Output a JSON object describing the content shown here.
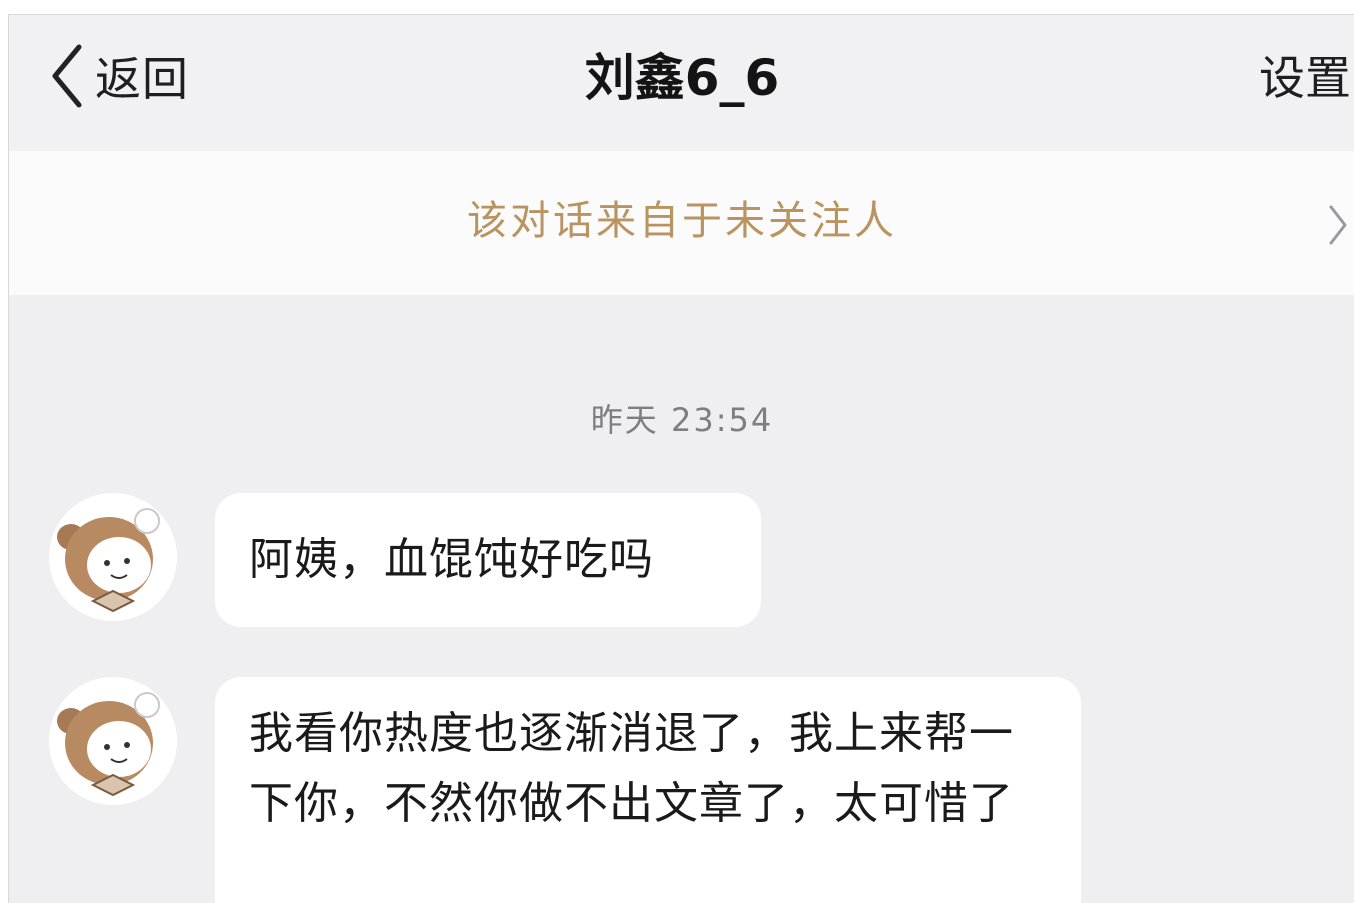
{
  "header": {
    "back_label": "返回",
    "title": "刘鑫6_6",
    "settings_label": "设置"
  },
  "notice": {
    "text": "该对话来自于未关注人"
  },
  "chat": {
    "timestamp": "昨天 23:54",
    "messages": [
      {
        "sender": "other",
        "avatar_icon": "cartoon-bear-avatar-icon",
        "text": "阿姨，血馄饨好吃吗"
      },
      {
        "sender": "other",
        "avatar_icon": "cartoon-bear-avatar-icon",
        "text": "我看你热度也逐渐消退了，我上来帮一下你，不然你做不出文章了，太可惜了"
      }
    ]
  },
  "colors": {
    "notice_text": "#b99460",
    "background": "#efeef1",
    "bubble": "#ffffff"
  }
}
